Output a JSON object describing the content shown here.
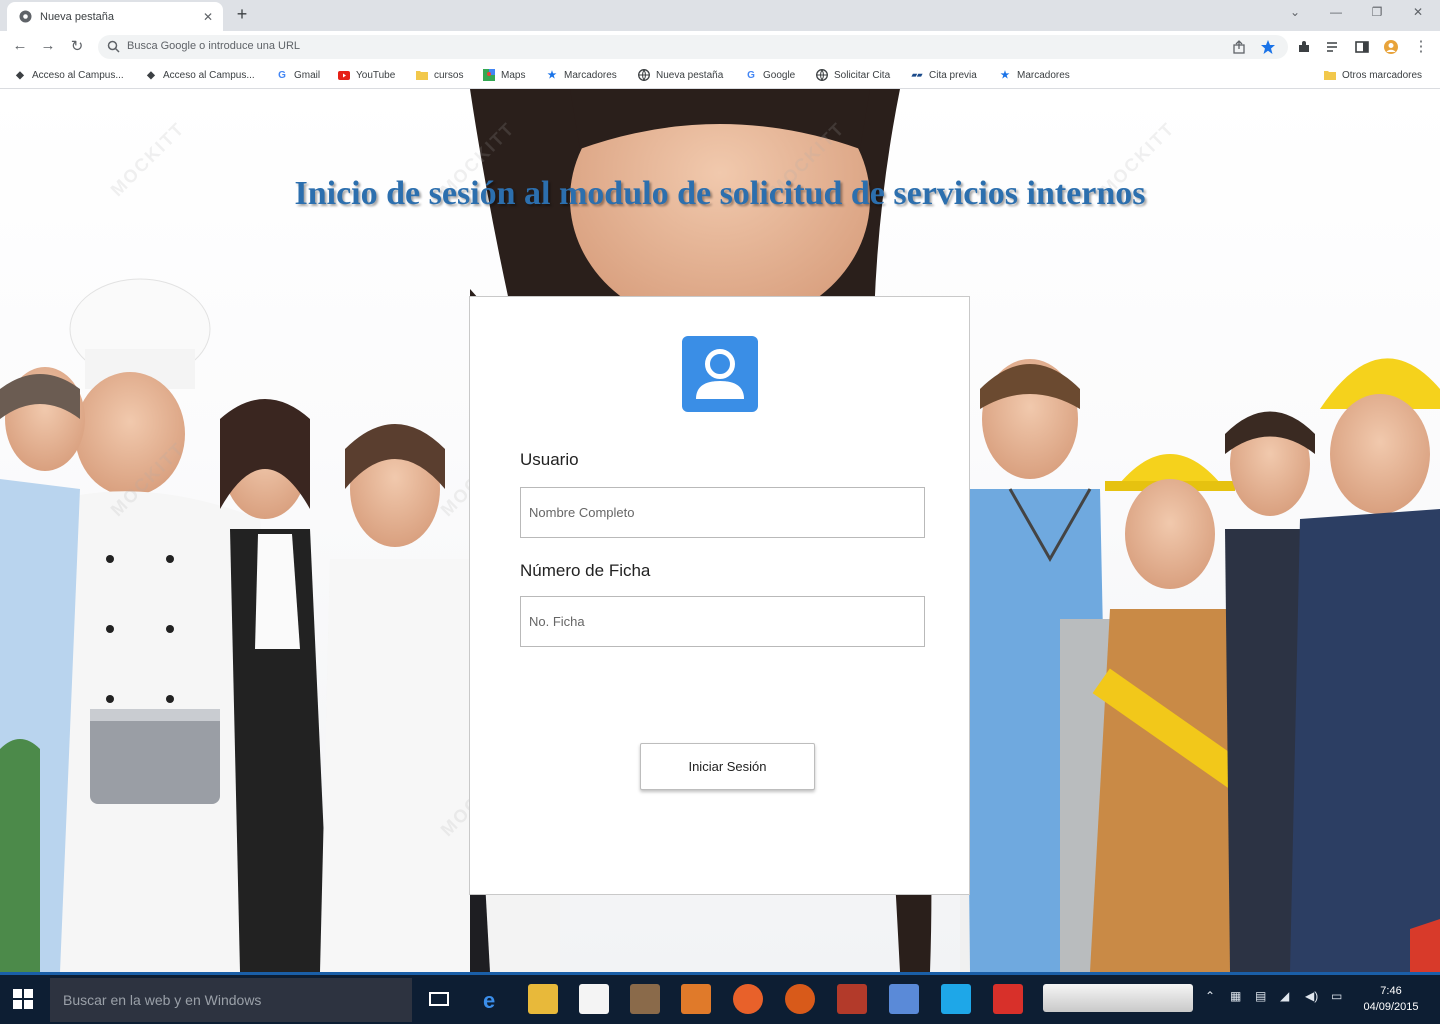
{
  "browser": {
    "tab_title": "Nueva pestaña",
    "new_tab": "+",
    "address_placeholder": "Busca Google o introduce una URL",
    "bookmarks": [
      {
        "label": "Acceso al Campus...",
        "icon": "diamond-icon",
        "color": "#222222"
      },
      {
        "label": "Acceso al Campus...",
        "icon": "diamond-icon",
        "color": "#222222"
      },
      {
        "label": "Gmail",
        "icon": "google-icon",
        "color": "#4285f4"
      },
      {
        "label": "YouTube",
        "icon": "youtube-icon",
        "color": "#e62117"
      },
      {
        "label": "cursos",
        "icon": "folder-icon",
        "color": "#f2c84b"
      },
      {
        "label": "Maps",
        "icon": "maps-icon",
        "color": "#34a853"
      },
      {
        "label": "Marcadores",
        "icon": "star-icon",
        "color": "#1a73e8"
      },
      {
        "label": "Nueva pestaña",
        "icon": "globe-icon",
        "color": "#3c4043"
      },
      {
        "label": "Google",
        "icon": "google-icon",
        "color": "#4285f4"
      },
      {
        "label": "Solicitar Cita",
        "icon": "globe-icon",
        "color": "#3c4043"
      },
      {
        "label": "Cita previa",
        "icon": "site-icon",
        "color": "#1a4a8a"
      },
      {
        "label": "Marcadores",
        "icon": "star-icon",
        "color": "#1a73e8"
      }
    ],
    "other_bookmarks": "Otros marcadores"
  },
  "page": {
    "title": "Inicio de sesión al modulo de solicitud de servicios internos",
    "usuario_label": "Usuario",
    "usuario_placeholder": "Nombre Completo",
    "ficha_label": "Número de Ficha",
    "ficha_placeholder": "No. Ficha",
    "login_button": "Iniciar Sesión",
    "watermark": "MOCKITT",
    "accent_color": "#3a8ee6",
    "title_color": "#2c6fae"
  },
  "taskbar": {
    "search_placeholder": "Buscar en la web y en Windows",
    "time": "7:46",
    "date": "04/09/2015"
  }
}
